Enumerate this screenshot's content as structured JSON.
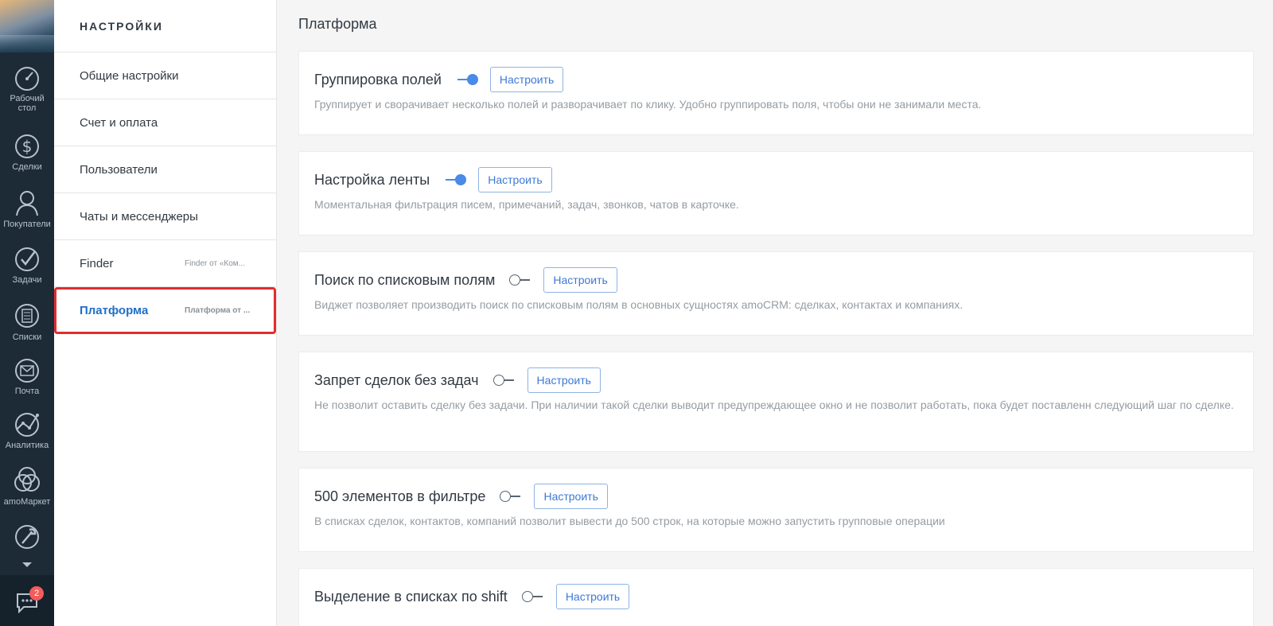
{
  "nav": {
    "items": [
      {
        "label": "Рабочий стол",
        "icon": "dashboard-icon"
      },
      {
        "label": "Сделки",
        "icon": "dollar-icon"
      },
      {
        "label": "Покупатели",
        "icon": "customers-icon"
      },
      {
        "label": "Задачи",
        "icon": "checkmark-icon"
      },
      {
        "label": "Списки",
        "icon": "lists-icon"
      },
      {
        "label": "Почта",
        "icon": "mail-icon"
      },
      {
        "label": "Аналитика",
        "icon": "analytics-icon"
      },
      {
        "label": "amoМаркет",
        "icon": "market-icon"
      },
      {
        "label": "",
        "icon": "settings-wrench-icon"
      }
    ],
    "chat_badge": "2"
  },
  "sidebar": {
    "title": "НАСТРОЙКИ",
    "items": [
      {
        "label": "Общие настройки",
        "sub": ""
      },
      {
        "label": "Счет и оплата",
        "sub": ""
      },
      {
        "label": "Пользователи",
        "sub": ""
      },
      {
        "label": "Чаты и мессенджеры",
        "sub": ""
      },
      {
        "label": "Finder",
        "sub": "Finder от «Ком..."
      },
      {
        "label": "Платформа",
        "sub": "Платформа от ..."
      }
    ]
  },
  "main": {
    "title": "Платформа",
    "configure_label": "Настроить",
    "cards": [
      {
        "name": "Группировка полей",
        "enabled": true,
        "desc": "Группирует и сворачивает несколько полей и разворачивает по клику. Удобно группировать поля, чтобы они не занимали места."
      },
      {
        "name": "Настройка ленты",
        "enabled": true,
        "desc": "Моментальная фильтрация писем, примечаний, задач, звонков, чатов в карточке."
      },
      {
        "name": "Поиск по списковым полям",
        "enabled": false,
        "desc": "Виджет позволяет производить поиск по списковым полям в основных сущностях amoCRM: сделках, контактах и компаниях."
      },
      {
        "name": "Запрет сделок без задач",
        "enabled": false,
        "desc": "Не позволит оставить сделку без задачи. При наличии такой сделки выводит предупреждающее окно и не позволит работать, пока будет поставленн следующий шаг по сделке."
      },
      {
        "name": "500 элементов в фильтре",
        "enabled": false,
        "desc": "В списках сделок, контактов, компаний позволит вывести до 500 строк, на которые можно запустить групповые операции"
      },
      {
        "name": "Выделение в списках по shift",
        "enabled": false,
        "desc": ""
      }
    ]
  },
  "colors": {
    "rail_bg": "#1c2b36",
    "accent": "#4a8ae8",
    "active_text": "#1f6fc8",
    "highlight_border": "#e12e2e"
  }
}
